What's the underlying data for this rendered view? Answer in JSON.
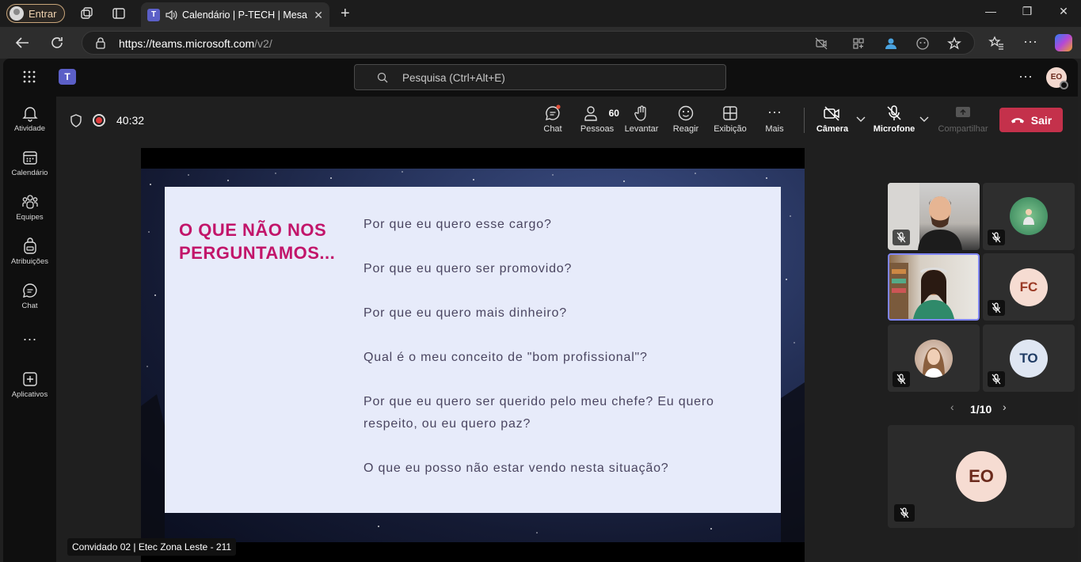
{
  "browser": {
    "profile_label": "Entrar",
    "tab_title": "Calendário | P-TECH | Mesa F",
    "url_host": "https://teams.microsoft.com",
    "url_path": "/v2/"
  },
  "teams": {
    "search_placeholder": "Pesquisa (Ctrl+Alt+E)",
    "user_initials": "EO",
    "rail": [
      {
        "label": "Atividade",
        "icon": "bell-icon"
      },
      {
        "label": "Calendário",
        "icon": "calendar-icon"
      },
      {
        "label": "Equipes",
        "icon": "teams-icon"
      },
      {
        "label": "Atribuições",
        "icon": "backpack-icon"
      },
      {
        "label": "Chat",
        "icon": "chat-icon"
      },
      {
        "label": "Aplicativos",
        "icon": "apps-icon"
      }
    ]
  },
  "meeting": {
    "timer": "40:32",
    "people_count": "60",
    "tools": {
      "chat": "Chat",
      "people": "Pessoas",
      "raise": "Levantar",
      "react": "Reagir",
      "view": "Exibição",
      "more": "Mais",
      "camera": "Câmera",
      "mic": "Microfone",
      "share": "Compartilhar"
    },
    "leave_label": "Sair",
    "presenter_tag": "Convidado 02 | Etec Zona Leste - 211",
    "pager": "1/10",
    "colors": {
      "leave": "#c4314b",
      "slide_title": "#c2156a",
      "accent": "#5b5fc7"
    }
  },
  "slide": {
    "title": "O QUE NÃO NOS PERGUNTAMOS...",
    "lines": [
      "Por que eu quero esse cargo?",
      "Por que eu quero ser promovido?",
      "Por que eu quero mais dinheiro?",
      "Qual é o meu conceito de \"bom profissional\"?",
      "Por que eu quero ser querido pelo meu chefe? Eu quero respeito, ou eu quero paz?",
      "O que eu posso não estar vendo nesta situação?"
    ]
  },
  "participants": {
    "fc": "FC",
    "to": "TO",
    "self": "EO"
  }
}
